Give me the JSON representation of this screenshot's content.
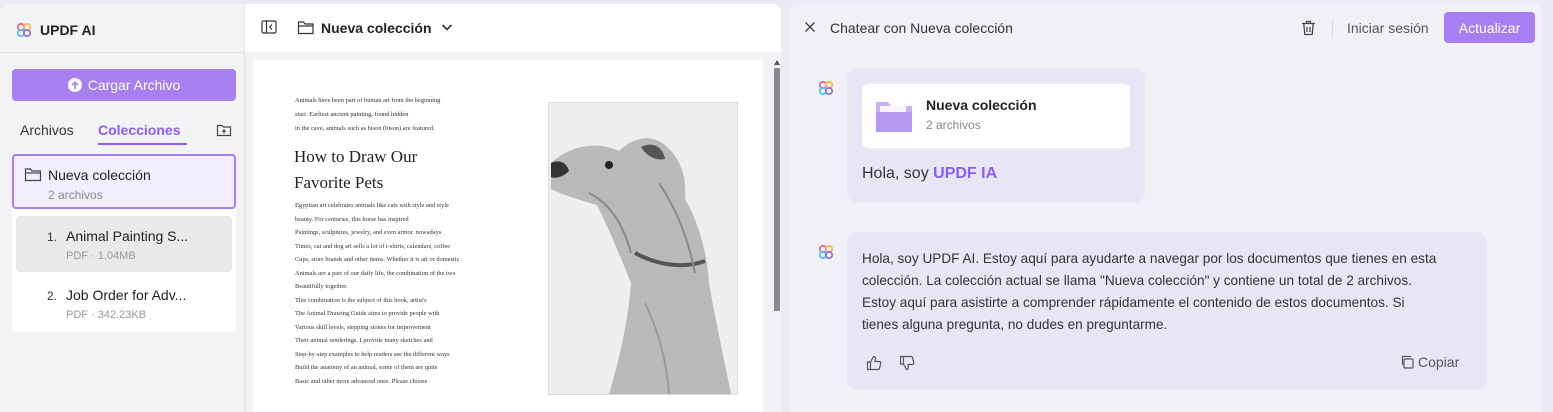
{
  "sidebar": {
    "brand": "UPDF AI",
    "upload_label": "Cargar Archivo",
    "tabs": [
      {
        "label": "Archivos",
        "active": false
      },
      {
        "label": "Colecciones",
        "active": true
      }
    ],
    "collection": {
      "name": "Nueva colección",
      "count": "2 archivos"
    },
    "files": [
      {
        "num": "1.",
        "name": "Animal Painting S...",
        "meta": "PDF · 1.04MB",
        "selected": true
      },
      {
        "num": "2.",
        "name": "Job Order for Adv...",
        "meta": "PDF · 342.23KB",
        "selected": false
      }
    ]
  },
  "viewer": {
    "title": "Nueva colección",
    "intro_lines": [
      "Animals have been part of human art from the beginning",
      "start. Earliest ancient painting, found hidden",
      "in the cave, animals such as bison (bison) are featured."
    ],
    "heading_lines": [
      "How to Draw Our",
      "Favorite Pets"
    ],
    "body_lines": [
      "Egyptian art celebrates animals like cats with style and style",
      "beauty. For centuries, this horse has inspired",
      "Paintings, sculptures, jewelry, and even armor. nowadays",
      "Times, cat and dog art sells a lot of t-shirts, calendars, coffee",
      "Cups, store brands and other items. Whether it is art or domestic",
      "Animals are a part of our daily life, the combination of the two",
      "Beautifully together.",
      "This combination is the subject of this book, artist's",
      "The Animal Drawing Guide aims to provide people with",
      "Various skill levels, stepping stones for improvement",
      "Their animal renderings. I provide many sketches and",
      "Step-by-step examples to help readers see the different ways",
      "Build the anatomy of an animal, some of them are quite",
      "Basic and other more advanced ones. Please choose"
    ]
  },
  "chat": {
    "title": "Chatear con Nueva colección",
    "login_label": "Iniciar sesión",
    "update_label": "Actualizar",
    "card": {
      "name": "Nueva colección",
      "count": "2 archivos"
    },
    "greeting_prefix": "Hola, soy ",
    "greeting_brand": "UPDF IA",
    "message_lines": [
      "Hola, soy UPDF AI. Estoy aquí para ayudarte a navegar por los documentos que tienes en esta",
      "colección. La colección actual se llama \"Nueva colección\" y contiene un total de 2 archivos.",
      "Estoy aquí para asistirte a comprender rápidamente el contenido de estos documentos. Si",
      "tienes alguna pregunta, no dudes en preguntarme."
    ],
    "copy_label": "Copiar"
  },
  "icons": {
    "brand": "updf-logo-icon",
    "upload": "arrow-up-circle-icon",
    "add_collection": "folder-plus-icon",
    "collection": "folder-icon",
    "toggle_sidebar": "sidebar-toggle-icon",
    "close": "close-icon",
    "trash": "trash-icon",
    "like": "thumbs-up-icon",
    "dislike": "thumbs-down-icon",
    "copy": "copy-icon"
  },
  "colors": {
    "accent": "#a77ff0",
    "accent_text": "#8b5cf6",
    "bubble": "#e8e6f5",
    "selection": "#f3eefd"
  }
}
